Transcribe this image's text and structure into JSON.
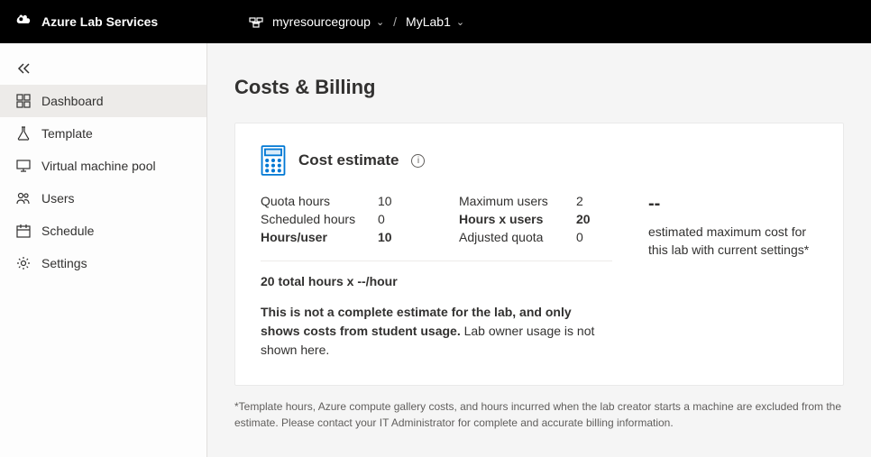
{
  "header": {
    "brand": "Azure Lab Services",
    "resource_group": "myresourcegroup",
    "lab_name": "MyLab1"
  },
  "sidebar": {
    "items": [
      {
        "label": "Dashboard",
        "icon": "dashboard-icon",
        "active": true
      },
      {
        "label": "Template",
        "icon": "flask-icon",
        "active": false
      },
      {
        "label": "Virtual machine pool",
        "icon": "monitor-icon",
        "active": false
      },
      {
        "label": "Users",
        "icon": "users-icon",
        "active": false
      },
      {
        "label": "Schedule",
        "icon": "calendar-icon",
        "active": false
      },
      {
        "label": "Settings",
        "icon": "gear-icon",
        "active": false
      }
    ]
  },
  "page": {
    "title": "Costs & Billing"
  },
  "card": {
    "title": "Cost estimate",
    "stats_left": {
      "quota_hours_label": "Quota hours",
      "quota_hours_value": "10",
      "scheduled_hours_label": "Scheduled hours",
      "scheduled_hours_value": "0",
      "hours_per_user_label": "Hours/user",
      "hours_per_user_value": "10"
    },
    "stats_right": {
      "max_users_label": "Maximum users",
      "max_users_value": "2",
      "hours_x_users_label": "Hours x users",
      "hours_x_users_value": "20",
      "adjusted_quota_label": "Adjusted quota",
      "adjusted_quota_value": "0"
    },
    "formula": "20 total hours x --/hour",
    "note_strong": "This is not a complete estimate for the lab, and only shows costs from student usage.",
    "note_rest": " Lab owner usage is not shown here.",
    "cost_amount": "--",
    "cost_desc": "estimated maximum cost for this lab with current settings*"
  },
  "footnote": "*Template hours, Azure compute gallery costs, and hours incurred when the lab creator starts a machine are excluded from the estimate. Please contact your IT Administrator for complete and accurate billing information."
}
